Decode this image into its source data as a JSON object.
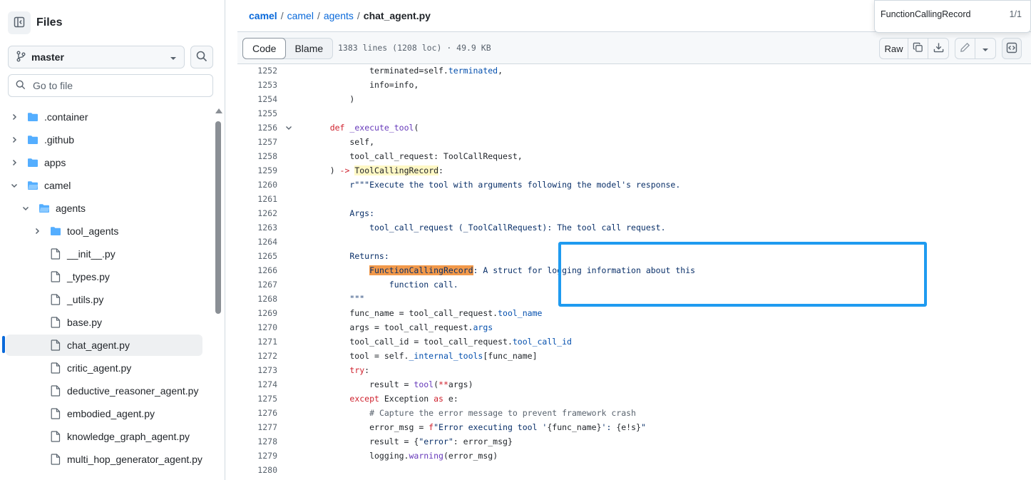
{
  "sidebar": {
    "title": "Files",
    "branch": "master",
    "goto_placeholder": "Go to file",
    "tree": [
      {
        "label": ".container",
        "kind": "folder",
        "expanded": false
      },
      {
        "label": ".github",
        "kind": "folder",
        "expanded": false
      },
      {
        "label": "apps",
        "kind": "folder",
        "expanded": false
      },
      {
        "label": "camel",
        "kind": "folder",
        "expanded": true
      },
      {
        "label": "agents",
        "kind": "folder",
        "expanded": true
      },
      {
        "label": "tool_agents",
        "kind": "folder",
        "expanded": false
      },
      {
        "label": "__init__.py",
        "kind": "file"
      },
      {
        "label": "_types.py",
        "kind": "file"
      },
      {
        "label": "_utils.py",
        "kind": "file"
      },
      {
        "label": "base.py",
        "kind": "file"
      },
      {
        "label": "chat_agent.py",
        "kind": "file",
        "active": true
      },
      {
        "label": "critic_agent.py",
        "kind": "file"
      },
      {
        "label": "deductive_reasoner_agent.py",
        "kind": "file"
      },
      {
        "label": "embodied_agent.py",
        "kind": "file"
      },
      {
        "label": "knowledge_graph_agent.py",
        "kind": "file"
      },
      {
        "label": "multi_hop_generator_agent.py",
        "kind": "file"
      }
    ]
  },
  "breadcrumb": {
    "parts": [
      "camel",
      "camel",
      "agents"
    ],
    "sep": "/",
    "current": "chat_agent.py"
  },
  "toolbar": {
    "code_tab": "Code",
    "blame_tab": "Blame",
    "meta": "1383 lines (1208 loc) · 49.9 KB",
    "raw": "Raw"
  },
  "find": {
    "query": "FunctionCallingRecord",
    "count": "1/1"
  },
  "code": [
    {
      "n": "1252",
      "html": "            terminated=self.<span class=\"at\">terminated</span>,"
    },
    {
      "n": "1253",
      "html": "            info=info,"
    },
    {
      "n": "1254",
      "html": "        )"
    },
    {
      "n": "1255",
      "html": ""
    },
    {
      "n": "1256",
      "html": "    <span class=\"kw\">def</span> <span class=\"fn\">_execute_tool</span>(",
      "fold": true
    },
    {
      "n": "1257",
      "html": "        self,"
    },
    {
      "n": "1258",
      "html": "        tool_call_request: ToolCallRequest,"
    },
    {
      "n": "1259",
      "html": "    ) <span class=\"kw\">-&gt;</span> <span class=\"hl\">ToolCallingRecord</span>:"
    },
    {
      "n": "1260",
      "html": "        <span class=\"st\">r\"\"\"Execute the tool with arguments following the model's response.</span>"
    },
    {
      "n": "1261",
      "html": ""
    },
    {
      "n": "1262",
      "html": "        <span class=\"st\">Args:</span>"
    },
    {
      "n": "1263",
      "html": "            <span class=\"st\">tool_call_request (_ToolCallRequest): The tool call request.</span>"
    },
    {
      "n": "1264",
      "html": ""
    },
    {
      "n": "1265",
      "html": "        <span class=\"st\">Returns:</span>"
    },
    {
      "n": "1266",
      "html": "            <span class=\"hlo st\">FunctionCallingRecord</span><span class=\"st\">: A struct for logging information about this</span>"
    },
    {
      "n": "1267",
      "html": "                <span class=\"st\">function call.</span>"
    },
    {
      "n": "1268",
      "html": "        <span class=\"st\">\"\"\"</span>"
    },
    {
      "n": "1269",
      "html": "        func_name = tool_call_request.<span class=\"at\">tool_name</span>"
    },
    {
      "n": "1270",
      "html": "        args = tool_call_request.<span class=\"at\">args</span>"
    },
    {
      "n": "1271",
      "html": "        tool_call_id = tool_call_request.<span class=\"at\">tool_call_id</span>"
    },
    {
      "n": "1272",
      "html": "        tool = self.<span class=\"at\">_internal_tools</span>[func_name]"
    },
    {
      "n": "1273",
      "html": "        <span class=\"kw\">try</span>:"
    },
    {
      "n": "1274",
      "html": "            result = <span class=\"fn\">tool</span>(<span class=\"kw\">**</span>args)"
    },
    {
      "n": "1275",
      "html": "        <span class=\"kw\">except</span> Exception <span class=\"kw\">as</span> e:"
    },
    {
      "n": "1276",
      "html": "            <span class=\"cm\"># Capture the error message to prevent framework crash</span>"
    },
    {
      "n": "1277",
      "html": "            error_msg = <span class=\"kw\">f</span><span class=\"st\">\"Error executing tool '</span>{func_name}<span class=\"st\">': </span>{e!s}<span class=\"st\">\"</span>"
    },
    {
      "n": "1278",
      "html": "            result = {<span class=\"st\">\"error\"</span>: error_msg}"
    },
    {
      "n": "1279",
      "html": "            logging.<span class=\"fn\">warning</span>(error_msg)"
    },
    {
      "n": "1280",
      "html": ""
    }
  ],
  "colors": {
    "link": "#0969da",
    "keyword": "#cf222e",
    "string": "#0a3069",
    "match_highlight": "#f2994a",
    "callout": "#1f9bf0"
  }
}
